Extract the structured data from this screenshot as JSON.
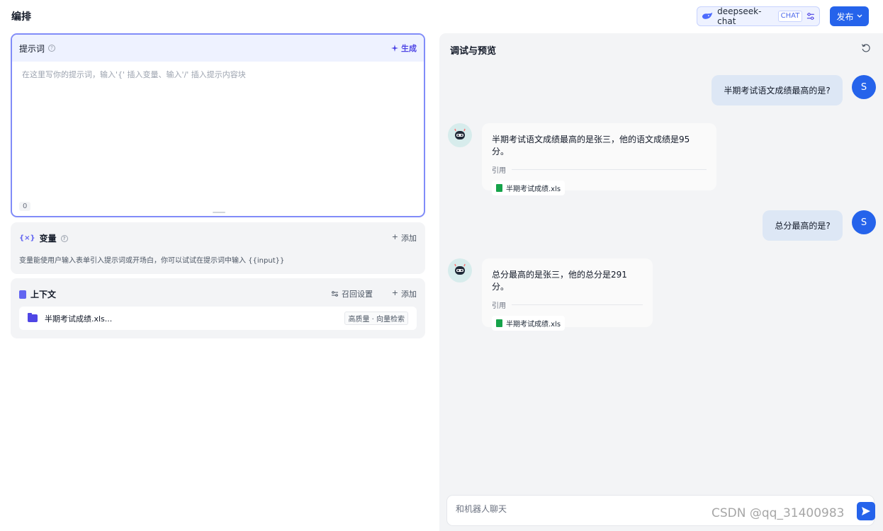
{
  "header": {
    "title": "编排"
  },
  "model_selector": {
    "name": "deepseek-chat",
    "tag": "CHAT",
    "icon": "whale-icon"
  },
  "publish": {
    "label": "发布"
  },
  "prompt": {
    "title": "提示词",
    "generate_label": "生成",
    "placeholder": "在这里写你的提示词，输入'{' 插入变量、输入'/' 插入提示内容块",
    "char_count": "0"
  },
  "variables": {
    "icon_text": "{×}",
    "title": "变量",
    "add_label": "添加",
    "description": "变量能使用户输入表单引入提示词或开场白，你可以试试在提示词中输入 {{input}}"
  },
  "context": {
    "title": "上下文",
    "recall_label": "召回设置",
    "add_label": "添加",
    "items": [
      {
        "name": "半期考试成绩.xls...",
        "tag": "高质量 · 向量检索"
      }
    ]
  },
  "debug": {
    "title": "调试与预览",
    "messages": [
      {
        "role": "user",
        "avatar": "S",
        "text": "半期考试语文成绩最高的是?"
      },
      {
        "role": "bot",
        "text": "半期考试语文成绩最高的是张三，他的语文成绩是95分。",
        "cite_label": "引用",
        "file": "半期考试成绩.xls"
      },
      {
        "role": "user",
        "avatar": "S",
        "text": "总分最高的是?"
      },
      {
        "role": "bot",
        "text": "总分最高的是张三，他的总分是291分。",
        "cite_label": "引用",
        "file": "半期考试成绩.xls"
      }
    ],
    "input_placeholder": "和机器人聊天"
  },
  "watermark": "CSDN @qq_31400983",
  "colors": {
    "accent": "#2563eb",
    "indigo": "#4f46e5",
    "panel_bg": "#f3f4f6",
    "user_bubble": "#dde7f5"
  }
}
